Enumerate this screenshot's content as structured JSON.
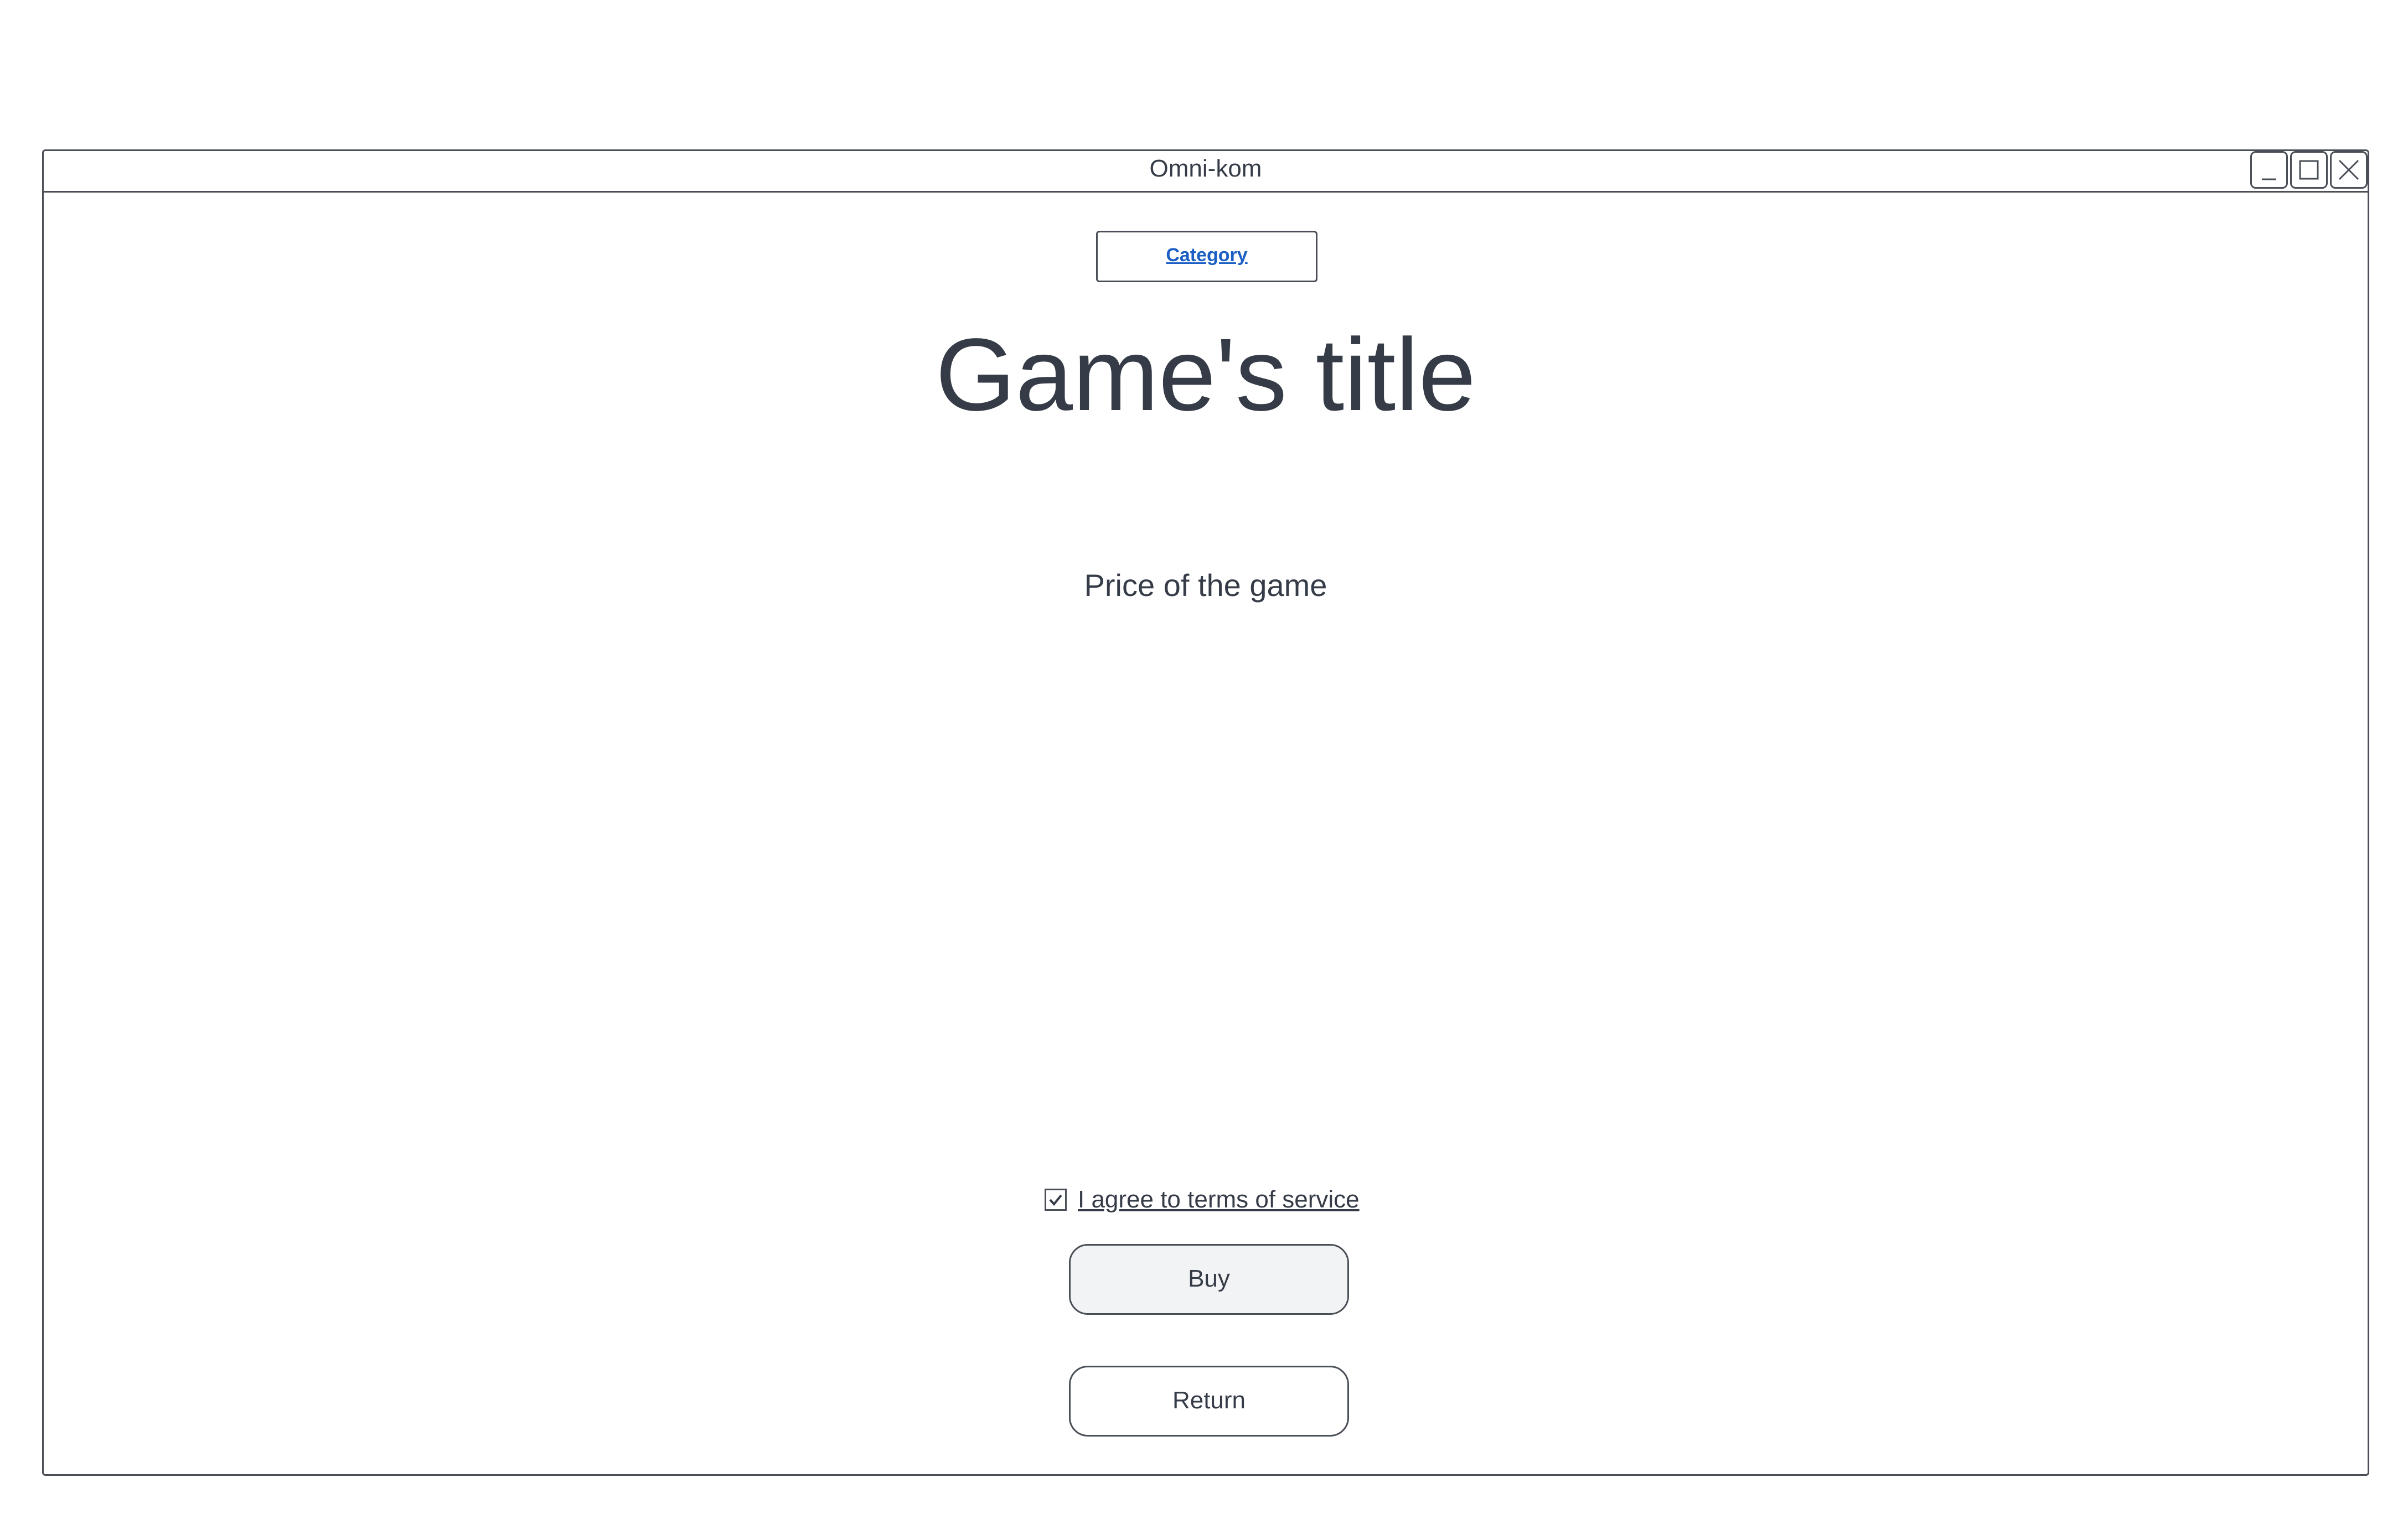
{
  "window": {
    "title": "Omni-kom",
    "controls": [
      "minimize-icon",
      "maximize-icon",
      "close-icon"
    ]
  },
  "main": {
    "category_label": "Category",
    "game_title": "Game's title",
    "price_label": "Price of the game",
    "terms": {
      "label": "I agree to terms of service",
      "checked": true
    },
    "buy_label": "Buy",
    "return_label": "Return"
  },
  "colors": {
    "text": "#353c47",
    "border": "#4a4f57",
    "link": "#1b5fc4",
    "buy_background": "#f2f3f5"
  }
}
